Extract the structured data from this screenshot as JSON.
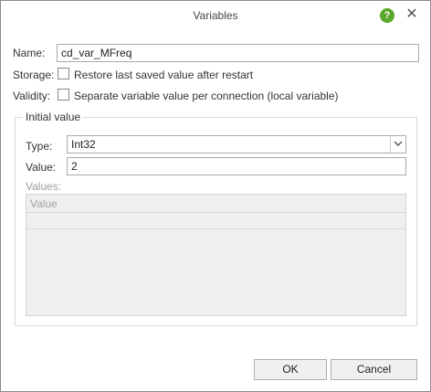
{
  "window": {
    "title": "Variables"
  },
  "titlebar": {
    "help_icon": "help-icon",
    "close_icon": "close-icon",
    "help_glyph": "?",
    "close_glyph": "✕"
  },
  "form": {
    "name_label": "Name:",
    "name_value": "cd_var_MFreq",
    "storage_label": "Storage:",
    "storage_option": "Restore last saved value after restart",
    "storage_checked": false,
    "validity_label": "Validity:",
    "validity_option": "Separate variable value per connection (local variable)",
    "validity_checked": false
  },
  "initial_value": {
    "group_title": "Initial value",
    "type_label": "Type:",
    "type_value": "Int32",
    "value_label": "Value:",
    "value_value": "2",
    "values_label": "Values:",
    "values_grid": {
      "column_header": "Value",
      "rows": [
        ""
      ]
    }
  },
  "buttons": {
    "ok": "OK",
    "cancel": "Cancel"
  },
  "colors": {
    "help_icon": "#5aa72b",
    "border": "#aaaaaa",
    "grid_bg": "#efefef"
  }
}
